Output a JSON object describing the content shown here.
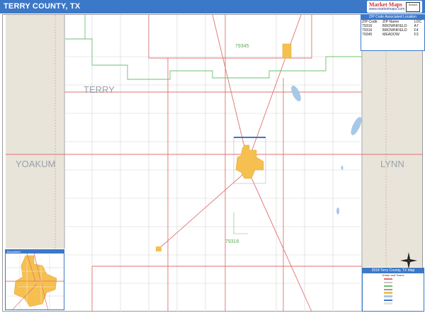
{
  "header": {
    "title": "TERRY COUNTY, TX"
  },
  "logo": {
    "line1": "Market Maps",
    "line2": "www.marketmaps.com",
    "badge": "Search"
  },
  "map": {
    "county_labels": {
      "terry": "TERRY",
      "yoakum": "YOAKUM",
      "lynn": "LYNN"
    },
    "zip_labels": {
      "north": "79345",
      "south": "79316"
    },
    "colors": {
      "county_fill": "#e8e4da",
      "city_fill": "#f5c050",
      "zip_line": "#6cc070",
      "highway": "#e07070",
      "road": "#c8c8c8",
      "water": "#a8c8e8",
      "accent": "#3c78c8"
    }
  },
  "zip_table": {
    "header": "ZIP Code Associated Location",
    "columns": [
      "ZIP Code",
      "ZIP Name",
      "LOC"
    ],
    "rows": [
      [
        "79316",
        "BROWNFIELD",
        "A7"
      ],
      [
        "79316",
        "BROWNFIELD",
        "F4"
      ],
      [
        "79345",
        "MEADOW",
        "F3"
      ]
    ]
  },
  "legend": {
    "title": "2018 Terry County, TX Map",
    "subtitle": "Urban and Towns"
  },
  "inset": {
    "title": "Brownfield"
  }
}
